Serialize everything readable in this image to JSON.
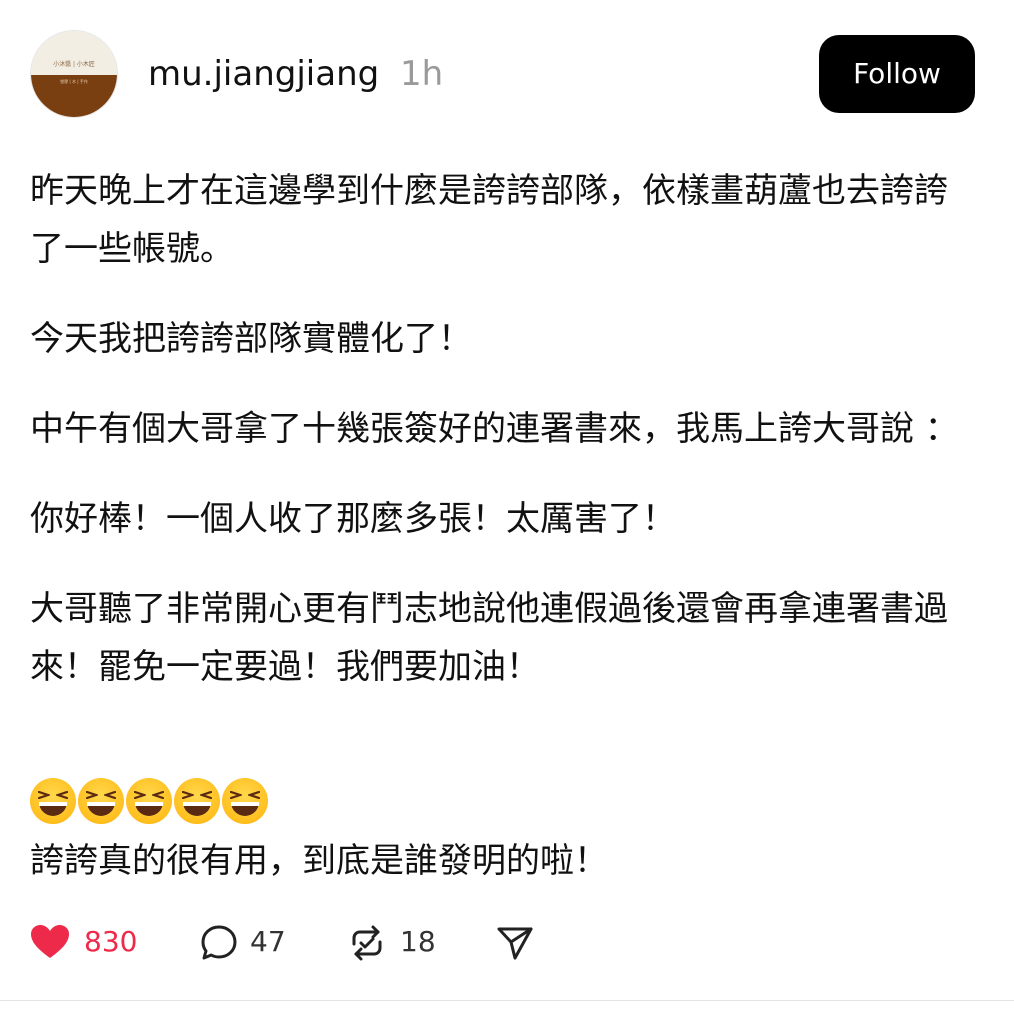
{
  "post": {
    "author": {
      "username": "mu.jiangjiang",
      "timestamp": "1h",
      "avatar_text_top": "小沐醬 | 小木匠",
      "avatar_text_bottom": "塑膠 | 木 | 手作"
    },
    "follow_label": "Follow",
    "paragraphs": [
      "昨天晚上才在這邊學到什麼是誇誇部隊，依樣畫葫蘆也去誇誇了一些帳號。",
      "今天我把誇誇部隊實體化了！",
      "中午有個大哥拿了十幾張簽好的連署書來，我馬上誇大哥說 ：",
      "你好棒！一個人收了那麼多張！太厲害了！",
      "大哥聽了非常開心更有鬥志地說他連假過後還會再拿連署書過來！罷免一定要過！我們要加油！"
    ],
    "emoji": [
      "grinning-squinting-face",
      "grinning-squinting-face",
      "grinning-squinting-face",
      "grinning-squinting-face",
      "grinning-squinting-face"
    ],
    "last_line": "誇誇真的很有用，到底是誰發明的啦！",
    "actions": {
      "likes": "830",
      "comments": "47",
      "reposts": "18",
      "like_icon": "heart-icon",
      "comment_icon": "comment-icon",
      "repost_icon": "repost-icon",
      "share_icon": "share-icon"
    },
    "colors": {
      "like": "#ee2a4a",
      "follow_bg": "#000000",
      "muted": "#9a9a9a"
    }
  }
}
